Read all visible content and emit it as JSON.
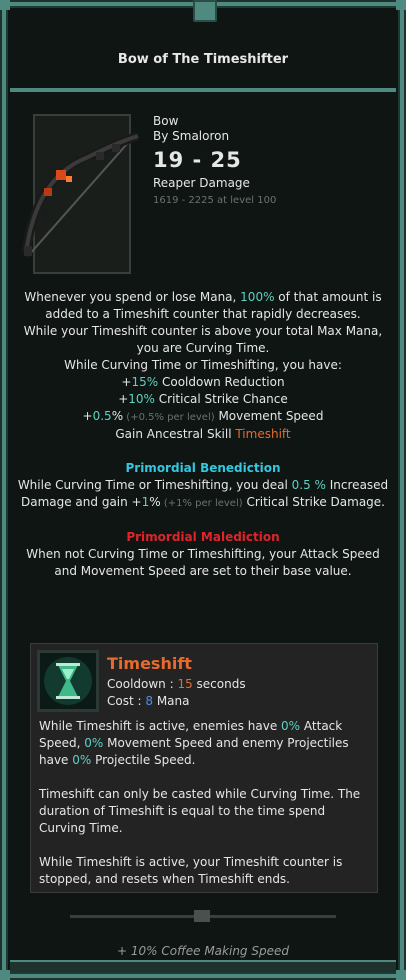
{
  "item": {
    "title": "Bow of The Timeshifter",
    "type": "Bow",
    "author": "By Smaloron",
    "damage": "19 - 25",
    "damage_type": "Reaper Damage",
    "level_range": "1619 - 2225 at level 100"
  },
  "description": {
    "l1a": "Whenever you spend or lose Mana, ",
    "l1pct": "100%",
    "l1b": " of that amount is added to a Timeshift counter that rapidly decreases.",
    "l2": "While your Timeshift counter is above your total Max Mana, you are Curving Time.",
    "l3": "While Curving Time or Timeshifting, you have:",
    "b1_plus": "+",
    "b1_val": "15%",
    "b1_text": " Cooldown Reduction",
    "b2_plus": "+",
    "b2_val": "10%",
    "b2_text": " Critical Strike Chance",
    "b3_plus": "+",
    "b3_val": "0.5",
    "b3_pct": "%",
    "b3_per": " (+0.5% per level)",
    "b3_text": " Movement Speed",
    "b4_text": "Gain Ancestral Skill ",
    "b4_skill": "Timeshift"
  },
  "benediction": {
    "heading": "Primordial Benediction",
    "t1": "While Curving Time or Timeshifting, you deal ",
    "v1": "0.5 %",
    "t2": " Increased Damage and gain +",
    "v2": "1",
    "t3": "%",
    "per": " (+1% per level)",
    "t4": " Critical Strike Damage."
  },
  "malediction": {
    "heading": "Primordial Malediction",
    "text": "When not Curving Time or Timeshifting, your Attack Speed and Movement Speed are set to their base value."
  },
  "skill": {
    "name": "Timeshift",
    "cooldown_label": "Cooldown : ",
    "cooldown_value": "15",
    "cooldown_unit": " seconds",
    "cost_label": "Cost : ",
    "cost_value": "8",
    "cost_unit": " Mana",
    "p1a": "While Timeshift is active, enemies have ",
    "p1v1": "0%",
    "p1b": " Attack Speed, ",
    "p1v2": "0%",
    "p1c": " Movement Speed and enemy Projectiles have ",
    "p1v3": "0%",
    "p1d": " Projectile Speed.",
    "p2": "Timeshift can only be casted while Curving Time. The duration of Timeshift is equal to the time spend Curving Time.",
    "p3": "While Timeshift is active, your Timeshift counter is stopped, and resets when Timeshift ends."
  },
  "footer": "+ 10% Coffee Making Speed",
  "colors": {
    "border": "#4e8a80",
    "highlight_teal": "#5fd0c2",
    "skill_orange": "#e86a2c",
    "benediction": "#33c8e0",
    "malediction": "#e0242a"
  }
}
